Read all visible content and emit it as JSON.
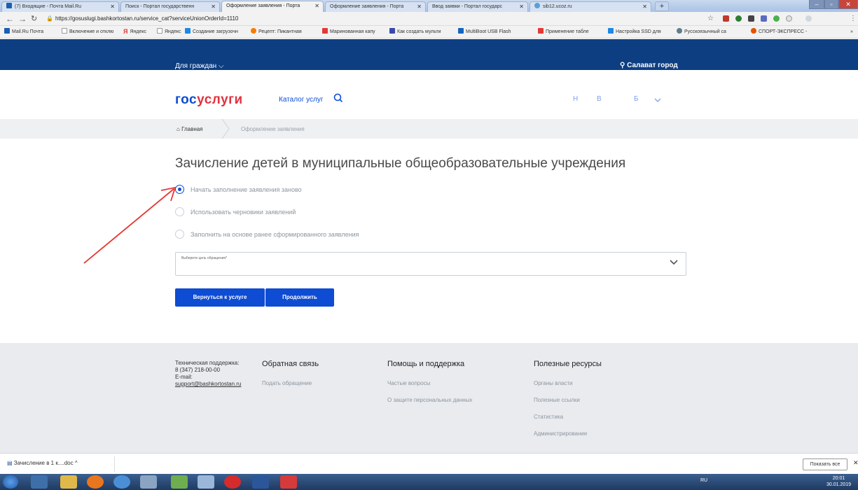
{
  "browser": {
    "tabs": [
      {
        "label": "(7) Входящие - Почта Mail.Ru",
        "icon": "mail-icon"
      },
      {
        "label": "Поиск - Портал государственн",
        "icon": "gosuslugi-icon"
      },
      {
        "label": "Оформление заявления - Порта",
        "icon": "gosuslugi-icon"
      },
      {
        "label": "Оформление заявления - Порта",
        "icon": "gosuslugi-icon"
      },
      {
        "label": "Ввод заявки - Портал государс",
        "icon": "gosuslugi-icon"
      },
      {
        "label": "sib12.ucoz.ru",
        "icon": "ucoz-icon"
      }
    ],
    "url": "https://gosuslugi.bashkortostan.ru/service_cat?serviceUnionOrderId=1110",
    "bookmarks": [
      "Mail.Ru Почта",
      "Включение и отклю",
      "Яндекс",
      "Яндекс",
      "Создание загрузочн",
      "Рецепт: Пикантная",
      "Маринованная капу",
      "Как создать мульти",
      "MultiBoot USB Flash",
      "Применение табле",
      "Настройка SSD для",
      "Русскоязычный са",
      "СПОРТ-ЭКСПРЕСС -"
    ]
  },
  "site": {
    "topbar": {
      "citizens": "Для граждан ⌵",
      "region": "Салават город"
    },
    "logo": {
      "part1": "гос",
      "part2": "услуги"
    },
    "catalog": "Каталог услуг",
    "header_links": [
      "Н",
      "В",
      "Б"
    ],
    "breadcrumb": {
      "home": "Главная",
      "current": "Оформление заявления"
    },
    "title": "Зачисление детей в муниципальные общеобразовательные учреждения",
    "options": [
      {
        "label": "Начать заполнение заявления заново",
        "selected": true
      },
      {
        "label": "Использовать черновики заявлений",
        "selected": false
      },
      {
        "label": "Заполнить на основе ранее сформированного заявления",
        "selected": false
      }
    ],
    "select_placeholder": "Выберите цель обращения*",
    "buttons": {
      "back": "Вернуться к услуге",
      "continue": "Продолжить"
    },
    "footer": {
      "support": {
        "label": "Техническая поддержка:",
        "phone": "8 (347) 218-00-00",
        "email_label": "E-mail:",
        "email": "support@bashkortostan.ru"
      },
      "feedback": {
        "title": "Обратная связь",
        "links": [
          "Подать обращение"
        ]
      },
      "help": {
        "title": "Помощь и поддержка",
        "links": [
          "Частые вопросы",
          "О защите персональных данных"
        ]
      },
      "resources": {
        "title": "Полезные ресурсы",
        "links": [
          "Органы власти",
          "Полезные ссылки",
          "Статистика",
          "Администрирование"
        ]
      }
    }
  },
  "downloads": {
    "item": "Зачисление в 1 к....doc",
    "show_all": "Показать все"
  },
  "taskbar": {
    "lang": "RU",
    "time": "20:01",
    "date": "30.01.2019"
  },
  "colors": {
    "brand_blue": "#0d4cd3",
    "topbar": "#0d3e82",
    "brand_red": "#e2323f"
  }
}
